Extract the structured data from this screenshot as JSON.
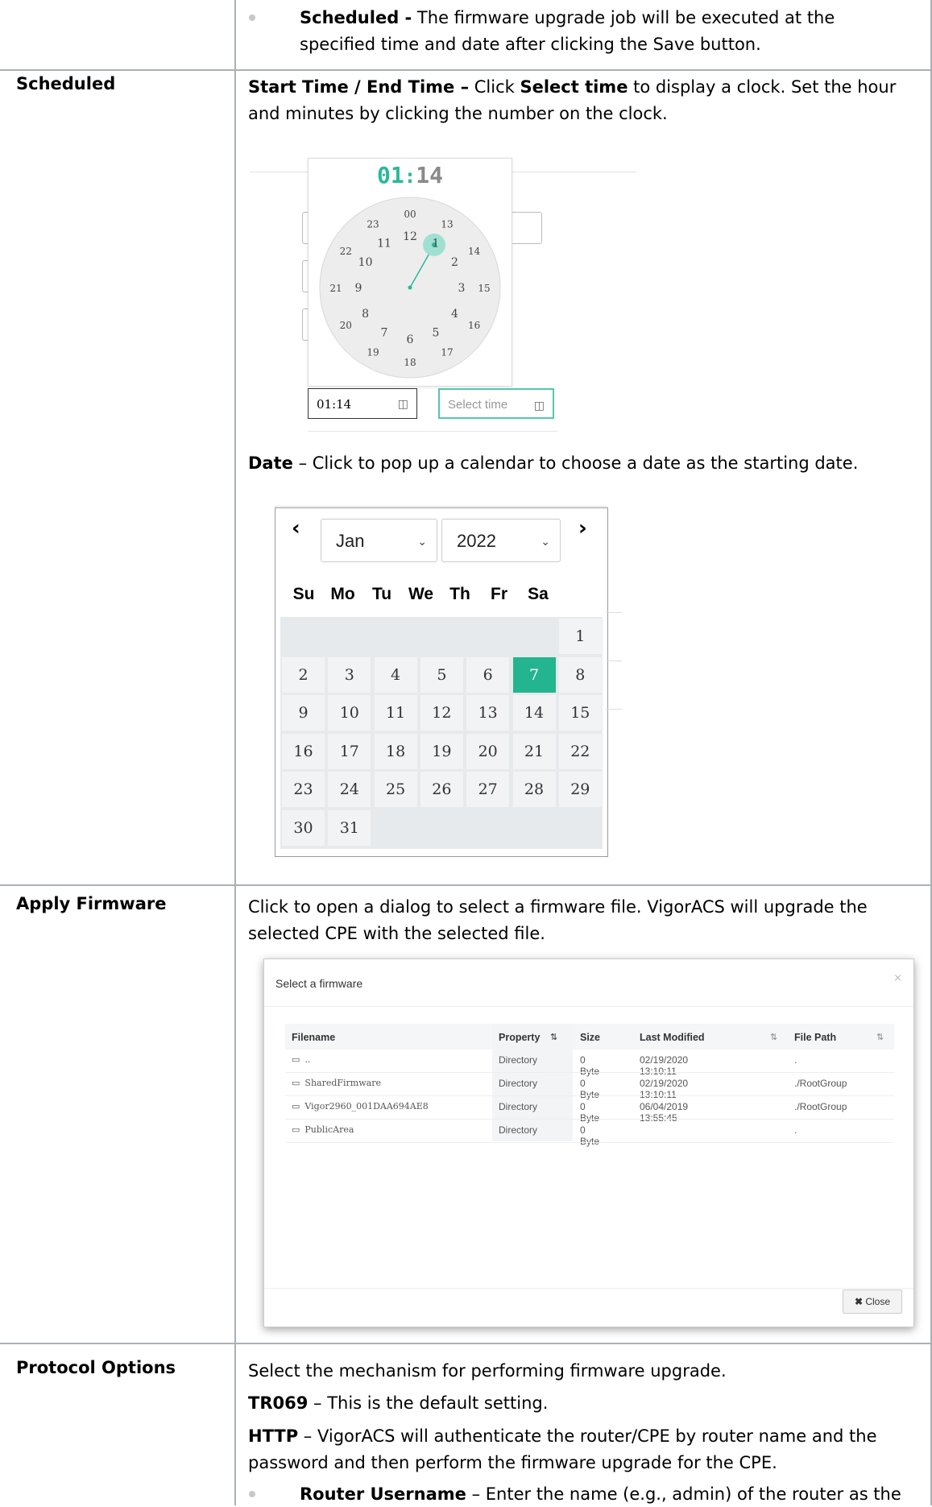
{
  "rows": {
    "scheduled_option": {
      "bullet_bold": "Scheduled -",
      "bullet_text_1": " The firmware upgrade job will be executed at the",
      "bullet_text_2": "specified time and date after clicking the Save button."
    },
    "scheduled": {
      "label": "Scheduled",
      "line1_bold_a": "Start Time / End Time –",
      "line1_text_a": " Click ",
      "line1_bold_b": "Select time",
      "line1_text_b": " to display a clock. Set the hour",
      "line2": "and minutes by clicking the number on the clock.",
      "date_bold": "Date",
      "date_text": " – Click to pop up a calendar to choose a date as the starting date."
    },
    "apply_firmware": {
      "label": "Apply Firmware",
      "line1": "Click to open a dialog to select a firmware file. VigorACS will upgrade the",
      "line2": "selected CPE with the selected file."
    },
    "protocol_options": {
      "label": "Protocol Options",
      "line1": "Select the mechanism for performing firmware upgrade.",
      "tr069_bold": "TR069",
      "tr069_text": " – This is the default setting.",
      "http_bold": "HTTP",
      "http_text_1": " – VigorACS will authenticate the router/CPE by router name and the",
      "http_text_2": "password and then perform the firmware upgrade for the CPE.",
      "bullet_bold": "Router Username",
      "bullet_text": " – Enter the name (e.g., admin) of the router as the"
    }
  },
  "clock": {
    "time_hour": "01",
    "time_sep": ":",
    "time_min": "14",
    "outer_numbers": [
      "00",
      "13",
      "14",
      "15",
      "16",
      "17",
      "18",
      "19",
      "20",
      "21",
      "22",
      "23"
    ],
    "inner_numbers": [
      "12",
      "1",
      "2",
      "3",
      "4",
      "5",
      "6",
      "7",
      "8",
      "9",
      "10",
      "11"
    ],
    "start_value": "01:14",
    "end_placeholder": "Select time",
    "accent": "#2bb89a"
  },
  "calendar": {
    "month": "Jan",
    "year": "2022",
    "weekdays": [
      "Su",
      "Mo",
      "Tu",
      "We",
      "Th",
      "Fr",
      "Sa"
    ],
    "days": [
      "1",
      "2",
      "3",
      "4",
      "5",
      "6",
      "7",
      "8",
      "9",
      "10",
      "11",
      "12",
      "13",
      "14",
      "15",
      "16",
      "17",
      "18",
      "19",
      "20",
      "21",
      "22",
      "23",
      "24",
      "25",
      "26",
      "27",
      "28",
      "29",
      "30",
      "31"
    ],
    "first_weekday_index": 6,
    "selected_day": "7",
    "prev_icon": "‹",
    "next_icon": "›",
    "accent": "#22b58f"
  },
  "firmware_dialog": {
    "title": "Select a firmware",
    "close_x": "×",
    "columns": [
      "Filename",
      "Property",
      "Size",
      "Last Modified",
      "File Path"
    ],
    "rows": [
      {
        "name": "..",
        "property": "Directory",
        "size": "0 Byte",
        "modified": "02/19/2020 13:10:11",
        "path": "."
      },
      {
        "name": "SharedFirmware",
        "property": "Directory",
        "size": "0 Byte",
        "modified": "02/19/2020 13:10:11",
        "path": "./RootGroup"
      },
      {
        "name": "Vigor2960_001DAA694AE8",
        "property": "Directory",
        "size": "0 Byte",
        "modified": "06/04/2019 13:55:45",
        "path": "./RootGroup"
      },
      {
        "name": "PublicArea",
        "property": "Directory",
        "size": "0 Byte",
        "modified": "",
        "path": "."
      }
    ],
    "close_label": "Close"
  }
}
